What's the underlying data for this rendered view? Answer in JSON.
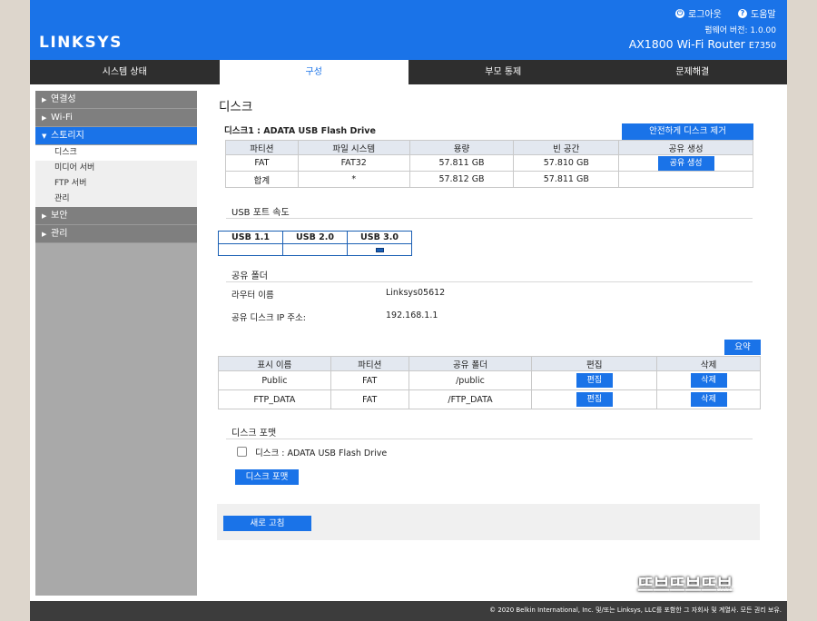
{
  "header": {
    "logo": "LINKSYS",
    "logout": "로그아웃",
    "help": "도움말",
    "firmware": "펌웨어 버전: 1.0.00",
    "model": "AX1800 Wi-Fi Router",
    "model_code": "E7350"
  },
  "nav": [
    "시스템 상태",
    "구성",
    "부모 통제",
    "문제해결"
  ],
  "sidebar": {
    "items": [
      {
        "label": "연결성"
      },
      {
        "label": "Wi-Fi"
      },
      {
        "label": "스토리지"
      },
      {
        "label": "보안"
      },
      {
        "label": "관리"
      }
    ],
    "subitems": [
      "디스크",
      "미디어 서버",
      "FTP 서버",
      "관리"
    ]
  },
  "page": {
    "title": "디스크",
    "disk_heading": "디스크1 : ADATA USB Flash Drive",
    "safe_remove": "안전하게 디스크 제거",
    "disk_table": {
      "headers": [
        "파티션",
        "파일 시스템",
        "용량",
        "빈 공간",
        "공유 생성"
      ],
      "rows": [
        [
          "FAT",
          "FAT32",
          "57.811 GB",
          "57.810 GB"
        ],
        [
          "합계",
          "*",
          "57.812 GB",
          "57.811 GB"
        ]
      ],
      "create_share": "공유 생성"
    },
    "usb_section": "USB 포트 속도",
    "usb_headers": [
      "USB 1.1",
      "USB 2.0",
      "USB 3.0"
    ],
    "share_section": "공유 폴더",
    "router_name_label": "라우터 이름",
    "router_name": "Linksys05612",
    "ip_label": "공유 디스크 IP 주소:",
    "ip": "192.168.1.1",
    "summary": "요약",
    "share_table": {
      "headers": [
        "표시 이름",
        "파티션",
        "공유 폴더",
        "편집",
        "삭제"
      ],
      "rows": [
        [
          "Public",
          "FAT",
          "/public"
        ],
        [
          "FTP_DATA",
          "FAT",
          "/FTP_DATA"
        ]
      ],
      "edit": "편집",
      "delete": "삭제"
    },
    "format_section": "디스크 포맷",
    "format_option": "디스크 : ADATA USB Flash Drive",
    "format_button": "디스크 포맷",
    "refresh": "새로 고침"
  },
  "footer": "© 2020 Belkin International, Inc. 및/또는 Linksys, LLC를 포함한 그 자회사 및 계열사. 모든 권리 보유.",
  "watermark": "뜨브뜨브뜨브",
  "watermark_url": "www.ddnbmg.com"
}
